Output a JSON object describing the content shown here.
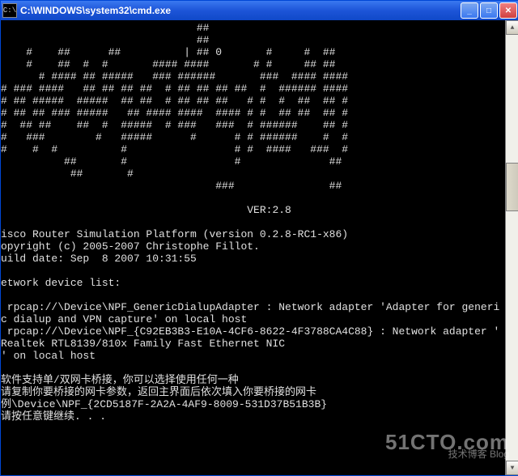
{
  "window": {
    "title": "C:\\WINDOWS\\system32\\cmd.exe",
    "icon_glyph": "C:\\"
  },
  "buttons": {
    "minimize": "_",
    "maximize": "□",
    "close": "✕"
  },
  "ascii_art": [
    "                               ##",
    "                               ##",
    "    #    ##      ##          | ## 0       #     #  ##",
    "    #    ##  #  #       #### ####       # #     ## ##",
    "      # #### ## #####   ### ######       ###  #### ####",
    "# ### ####   ## ## ## ##  # ## ## ## ##  #  ###### ####",
    "# ## #####  #####  ## ##  # ## ## ##   # #  #  ##  ## #",
    "# ## ## ### #####   ## #### ####  #### # #  ## ##  ## #",
    "#  ## ##    ##  #  #####  # ###   ###  # ######    ## #",
    "#   ###        #   #####      #      # # ######    #  #",
    "#    #  #          #                 # #  ####   ###  #",
    "          ##       #                 #              ##",
    "           ##       #",
    "                                  ###               ##",
    "",
    "                                       VER:2.8",
    ""
  ],
  "body_lines": [
    "isco Router Simulation Platform (version 0.2.8-RC1-x86)",
    "opyright (c) 2005-2007 Christophe Fillot.",
    "uild date: Sep  8 2007 10:31:55",
    "",
    "etwork device list:",
    "",
    " rpcap://\\Device\\NPF_GenericDialupAdapter : Network adapter 'Adapter for generi",
    "c dialup and VPN capture' on local host",
    " rpcap://\\Device\\NPF_{C92EB3B3-E10A-4CF6-8622-4F3788CA4C88} : Network adapter '",
    "Realtek RTL8139/810x Family Fast Ethernet NIC",
    "' on local host",
    "",
    "软件支持单/双网卡桥接，你可以选择使用任何一种",
    "请复制你要桥接的网卡参数，返回主界面后依次填入你要桥接的网卡",
    "例\\Device\\NPF_{2CD5187F-2A2A-4AF9-8009-531D37B51B3B}",
    "请按任意键继续. . ."
  ],
  "watermark": {
    "main": "51CTO.com",
    "sub": "技术博客  Blog"
  }
}
